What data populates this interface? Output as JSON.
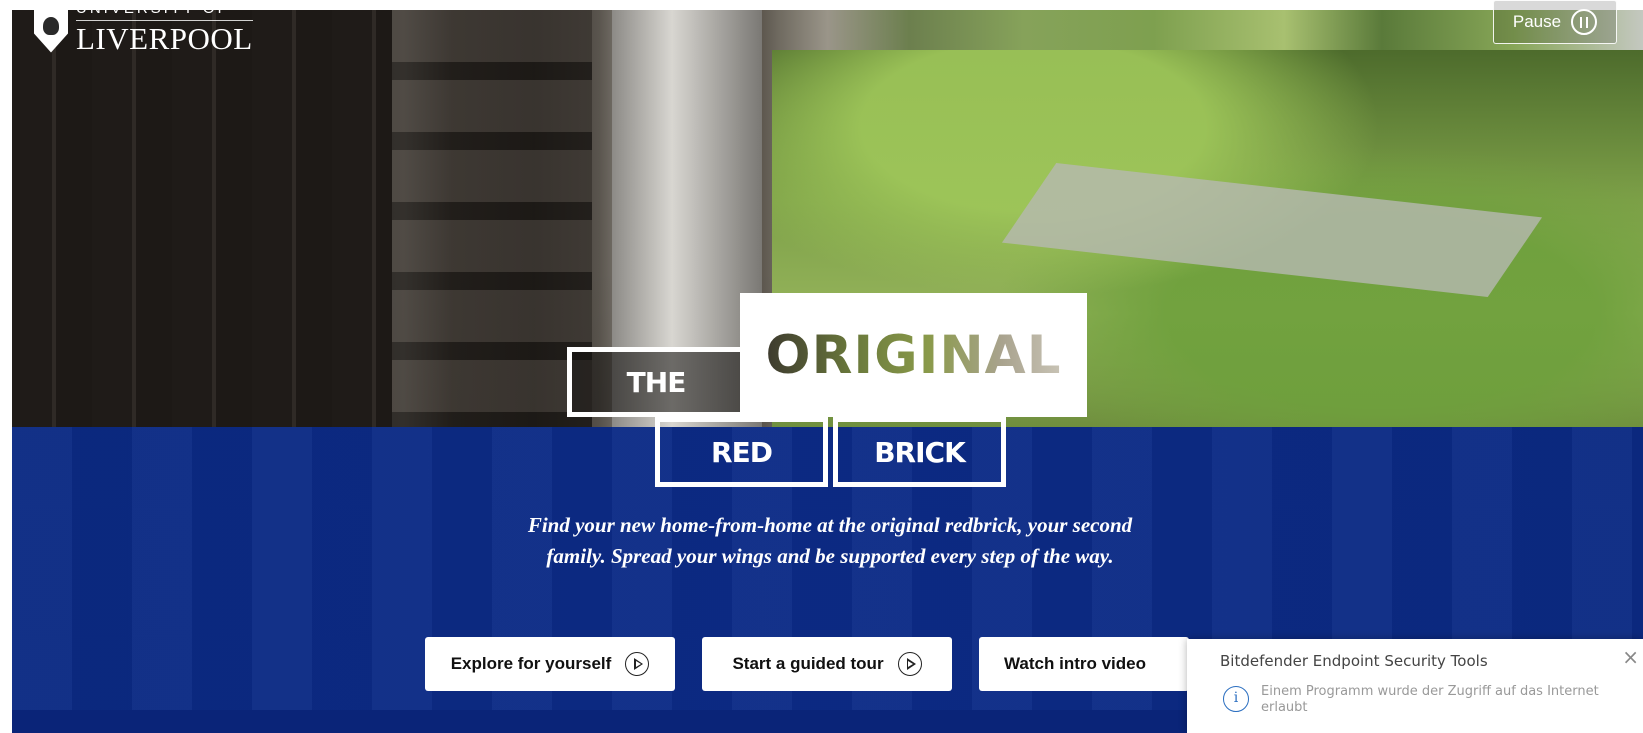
{
  "logo": {
    "line1": "UNIVERSITY OF",
    "line2": "LIVERPOOL"
  },
  "pause_button": {
    "label": "Pause",
    "icon": "pause-icon"
  },
  "hero": {
    "word_the": "THE",
    "word_original": "ORIGINAL",
    "word_red": "RED",
    "word_brick": "BRICK",
    "tagline": "Find your new home-from-home at the original redbrick, your second family. Spread your wings and be supported every step of the way."
  },
  "cta": {
    "explore": "Explore for yourself",
    "guided": "Start a guided tour",
    "video": "Watch intro video",
    "icon": "play-circle-icon"
  },
  "toast": {
    "title": "Bitdefender Endpoint Security Tools",
    "message": "Einem Programm wurde der Zugriff auf das Internet erlaubt",
    "close": "×",
    "icon": "info-icon",
    "icon_glyph": "i"
  },
  "colors": {
    "brand_blue": "#0b2a83",
    "white": "#ffffff"
  }
}
